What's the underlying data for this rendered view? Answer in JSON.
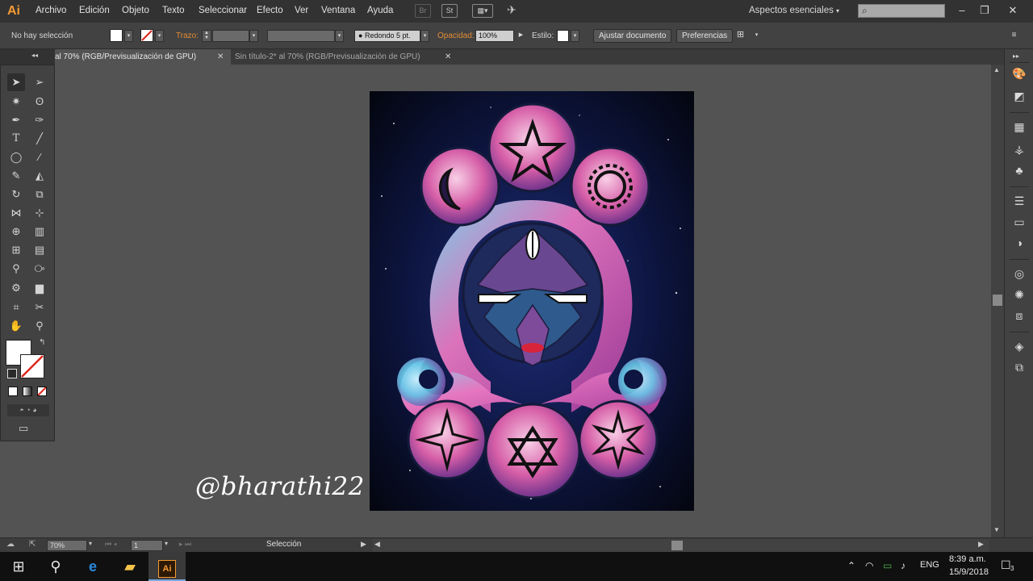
{
  "app": {
    "logo_text": "Ai",
    "menu": [
      "Archivo",
      "Edición",
      "Objeto",
      "Texto",
      "Seleccionar",
      "Efecto",
      "Ver",
      "Ventana",
      "Ayuda"
    ],
    "menubar_icons": [
      "bridge-icon",
      "stock-icon",
      "arrange-documents-icon",
      "brush-feather-icon"
    ],
    "workspace_label": "Aspectos esenciales",
    "search_placeholder": ""
  },
  "control_bar": {
    "selection_status": "No hay selección",
    "stroke_label": "Trazo:",
    "brush_value": "Redondo 5 pt.",
    "opacity_label": "Opacidad:",
    "opacity_value": "100%",
    "style_label": "Estilo:",
    "fit_document_button": "Ajustar documento",
    "preferences_button": "Preferencias"
  },
  "tabs": [
    {
      "label": "al 70% (RGB/Previsualización de GPU)",
      "active": true
    },
    {
      "label": "Sin título-2* al 70% (RGB/Previsualización de GPU)",
      "active": false
    }
  ],
  "tab_close_glyph": "✕",
  "canvas": {
    "watermark": "@bharathi22"
  },
  "status_bar": {
    "zoom": "70%",
    "artboard_number": "1",
    "tool_status": "Selección"
  },
  "taskbar": {
    "time": "8:39 a.m.",
    "date": "15/9/2018",
    "language": "ENG",
    "notification_count": "3"
  },
  "colors": {
    "accent_orange": "#e28d35",
    "panel_dark": "#323232",
    "panel_mid": "#424242",
    "canvas_bg": "#535353"
  }
}
